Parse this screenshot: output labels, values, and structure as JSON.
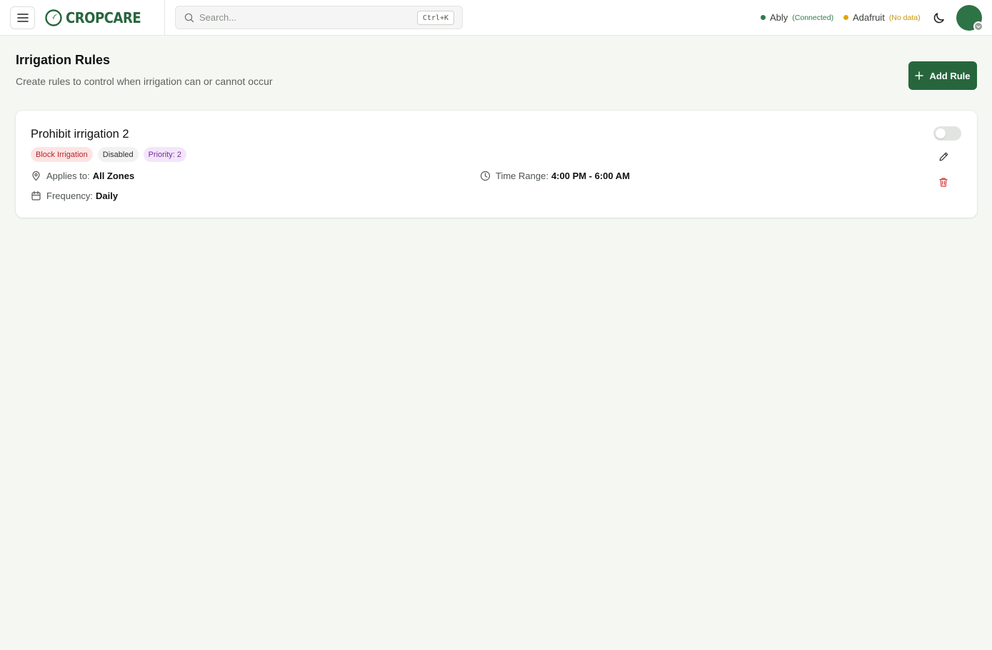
{
  "header": {
    "brand": "CROPCARE",
    "search": {
      "placeholder": "Search...",
      "shortcut": "Ctrl+K"
    },
    "connections": [
      {
        "name": "Ably",
        "state": "(Connected)",
        "dot_color": "#2e7d4a",
        "state_color": "#2e7d4a"
      },
      {
        "name": "Adafruit",
        "state": "(No data)",
        "dot_color": "#e0a800",
        "state_color": "#c9960a"
      }
    ]
  },
  "page": {
    "title": "Irrigation Rules",
    "subtitle": "Create rules to control when irrigation can or cannot occur",
    "add_button_label": "Add Rule"
  },
  "rules": [
    {
      "name": "Prohibit irrigation 2",
      "badges": {
        "type": "Block Irrigation",
        "status": "Disabled",
        "priority": "Priority: 2"
      },
      "applies_label": "Applies to:",
      "applies_value": "All Zones",
      "frequency_label": "Frequency:",
      "frequency_value": "Daily",
      "time_label": "Time Range:",
      "time_value": "4:00 PM - 6:00 AM",
      "enabled": false
    }
  ],
  "colors": {
    "brand": "#27663d",
    "danger": "#d23a3a"
  }
}
